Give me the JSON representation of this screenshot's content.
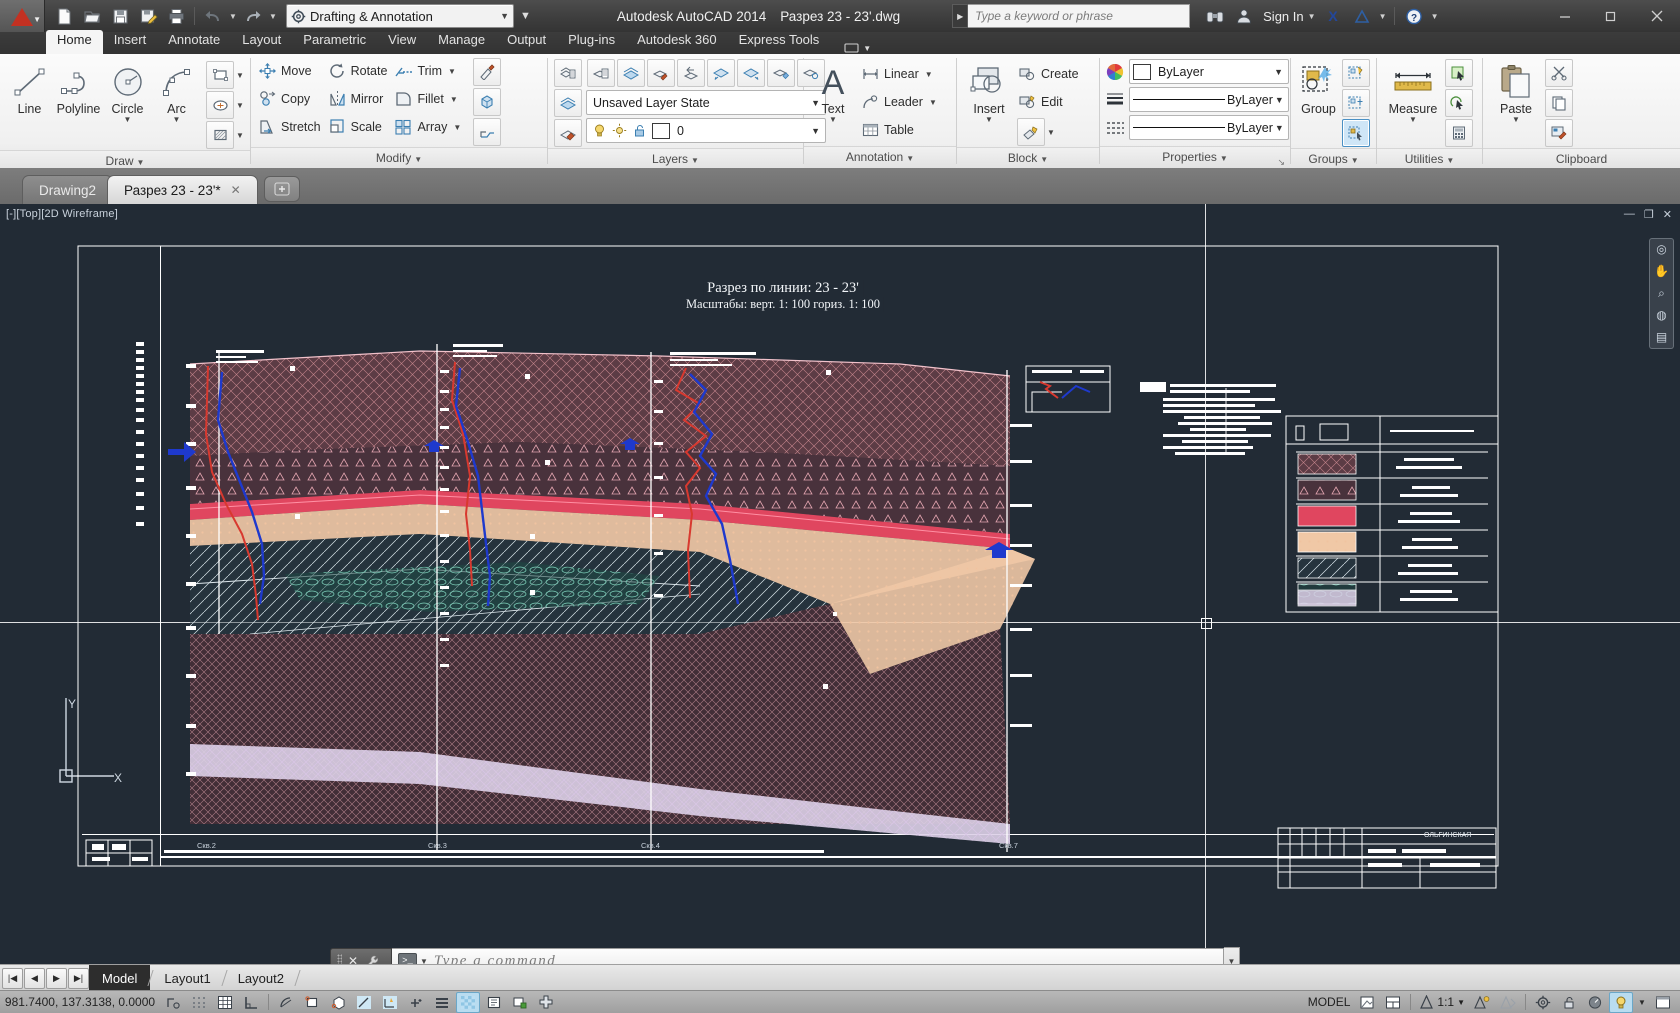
{
  "titlebar": {
    "app_title": "Autodesk AutoCAD 2014",
    "document_title": "Разрез 23 - 23'.dwg",
    "workspace": "Drafting & Annotation",
    "search_placeholder": "Type a keyword or phrase",
    "sign_in": "Sign In",
    "quick_access": [
      {
        "name": "new-file",
        "icon": "new-document-icon"
      },
      {
        "name": "open-file",
        "icon": "open-folder-icon"
      },
      {
        "name": "save-file",
        "icon": "save-disk-icon"
      },
      {
        "name": "save-as",
        "icon": "save-as-icon"
      },
      {
        "name": "plot",
        "icon": "printer-icon"
      },
      {
        "name": "undo",
        "icon": "undo-arrow-icon"
      },
      {
        "name": "redo",
        "icon": "redo-arrow-icon"
      }
    ],
    "window_buttons": {
      "minimize": "—",
      "maximize": "❐",
      "close": "✕"
    }
  },
  "ribbon_tabs": [
    {
      "label": "Home",
      "active": true
    },
    {
      "label": "Insert",
      "active": false
    },
    {
      "label": "Annotate",
      "active": false
    },
    {
      "label": "Layout",
      "active": false
    },
    {
      "label": "Parametric",
      "active": false
    },
    {
      "label": "View",
      "active": false
    },
    {
      "label": "Manage",
      "active": false
    },
    {
      "label": "Output",
      "active": false
    },
    {
      "label": "Plug-ins",
      "active": false
    },
    {
      "label": "Autodesk 360",
      "active": false
    },
    {
      "label": "Express Tools",
      "active": false
    }
  ],
  "panels": {
    "draw": {
      "title": "Draw",
      "buttons": [
        {
          "label": "Line",
          "icon": "line-icon"
        },
        {
          "label": "Polyline",
          "icon": "polyline-icon"
        },
        {
          "label": "Circle",
          "icon": "circle-icon",
          "dropdown": true
        },
        {
          "label": "Arc",
          "icon": "arc-icon",
          "dropdown": true
        }
      ],
      "small_icons": [
        "rectangle-icon",
        "ellipse-icon",
        "hatch-icon"
      ]
    },
    "modify": {
      "title": "Modify",
      "items": [
        {
          "label": "Move",
          "icon": "move-icon"
        },
        {
          "label": "Rotate",
          "icon": "rotate-icon"
        },
        {
          "label": "Trim",
          "icon": "trim-icon",
          "dropdown": true
        },
        {
          "label": "Copy",
          "icon": "copy-icon"
        },
        {
          "label": "Mirror",
          "icon": "mirror-icon"
        },
        {
          "label": "Fillet",
          "icon": "fillet-icon",
          "dropdown": true
        },
        {
          "label": "Stretch",
          "icon": "stretch-icon"
        },
        {
          "label": "Scale",
          "icon": "scale-icon"
        },
        {
          "label": "Array",
          "icon": "array-icon",
          "dropdown": true
        }
      ],
      "side_icons": [
        "match-properties-icon",
        "3d-solid-icon",
        "explode-icon"
      ]
    },
    "layers": {
      "title": "Layers",
      "layer_state": "Unsaved Layer State",
      "current_layer": "0",
      "layer_color": "#ffffff",
      "tool_icons": [
        "layer-properties-icon",
        "layer-make-current-icon",
        "layer-match-icon",
        "layer-previous-icon",
        "layer-isolate-icon",
        "layer-unisolate-icon",
        "layer-freeze-icon",
        "layer-off-icon"
      ],
      "state_icons": [
        "lightbulb-icon",
        "sun-icon",
        "unlock-icon"
      ]
    },
    "annotation": {
      "title": "Annotation",
      "big_button": {
        "label": "Text",
        "icon": "text-a-icon",
        "dropdown": true
      },
      "items": [
        {
          "label": "Linear",
          "icon": "linear-dimension-icon",
          "dropdown": true
        },
        {
          "label": "Leader",
          "icon": "leader-icon",
          "dropdown": true
        },
        {
          "label": "Table",
          "icon": "table-icon"
        }
      ]
    },
    "block": {
      "title": "Block",
      "big_button": {
        "label": "Insert",
        "icon": "insert-block-icon",
        "dropdown": true
      },
      "items": [
        {
          "label": "Create",
          "icon": "create-block-icon"
        },
        {
          "label": "Edit",
          "icon": "edit-block-icon"
        }
      ],
      "extra_icon": "block-attribute-icon"
    },
    "properties": {
      "title": "Properties",
      "color": "ByLayer",
      "linetype": "ByLayer",
      "lineweight": "ByLayer",
      "color_swatch": "#ffffff",
      "icons": [
        "color-wheel-icon",
        "lineweight-icon",
        "linetype-icon"
      ]
    },
    "groups": {
      "title": "Groups",
      "big_button": {
        "label": "Group",
        "icon": "group-icon"
      },
      "small_icons": [
        "ungroup-icon",
        "group-edit-icon",
        "group-selection-icon"
      ],
      "selected_icon": "group-selection-icon"
    },
    "utilities": {
      "title": "Utilities",
      "big_button": {
        "label": "Measure",
        "icon": "measure-ruler-icon",
        "dropdown": true
      },
      "small_icons": [
        "quick-select-icon",
        "quick-calc-icon",
        "calculator-icon"
      ]
    },
    "clipboard": {
      "title": "Clipboard",
      "big_button": {
        "label": "Paste",
        "icon": "paste-icon",
        "dropdown": true
      },
      "small_icons": [
        "cut-icon",
        "copy-clip-icon",
        "match-properties-clip-icon"
      ]
    }
  },
  "drawing_tabs": [
    {
      "label": "Drawing2",
      "active": false,
      "modified": false
    },
    {
      "label": "Разрез 23 - 23'*",
      "active": true,
      "modified": true
    }
  ],
  "new_tab_icon": "add-tab-icon",
  "viewport": {
    "label": "[-][Top][2D Wireframe]",
    "drawing_title_line1": "Разрез по линии:  23 - 23'",
    "drawing_title_line2": "Масштабы: верт. 1: 100 гориз. 1: 100",
    "borehole_labels": [
      "Скв.2",
      "Скв.3",
      "Скв.4",
      "Скв.7"
    ],
    "titleblock_company": "ОЛЬГИНСКАЯ",
    "window_controls": [
      "minimize-viewport",
      "maximize-viewport",
      "close-viewport"
    ],
    "nav_bar_icons": [
      "pan-hand-icon",
      "zoom-extents-icon",
      "orbit-icon",
      "showmotion-icon",
      "steeringwheel-icon"
    ]
  },
  "command_line": {
    "placeholder": "Type a command",
    "prompt_icon": "command-prompt-icon",
    "close_icon": "✕",
    "customize_icon": "wrench-icon"
  },
  "layout_tabs": [
    {
      "label": "Model",
      "active": true
    },
    {
      "label": "Layout1",
      "active": false
    },
    {
      "label": "Layout2",
      "active": false
    }
  ],
  "status_bar": {
    "coordinates": "981.7400, 137.3138, 0.0000",
    "space_mode": "MODEL",
    "annotation_scale": "1:1",
    "left_toggles": [
      {
        "name": "infer-constraints-icon",
        "on": false
      },
      {
        "name": "snap-mode-icon",
        "on": false
      },
      {
        "name": "grid-display-icon",
        "on": false
      },
      {
        "name": "ortho-mode-icon",
        "on": false
      },
      {
        "name": "polar-tracking-icon",
        "on": false
      },
      {
        "name": "object-snap-icon",
        "on": false
      },
      {
        "name": "3d-object-snap-icon",
        "on": false
      },
      {
        "name": "object-snap-tracking-icon",
        "on": false
      },
      {
        "name": "dynamic-ucs-icon",
        "on": false
      },
      {
        "name": "dynamic-input-icon",
        "on": false
      },
      {
        "name": "lineweight-display-icon",
        "on": false
      },
      {
        "name": "transparency-icon",
        "on": true
      },
      {
        "name": "selection-cycling-icon",
        "on": false
      },
      {
        "name": "annotation-monitor-icon",
        "on": false
      },
      {
        "name": "add-toggle-icon",
        "on": false
      }
    ],
    "right_items": [
      {
        "name": "model-space-button",
        "label": "MODEL"
      },
      {
        "name": "layout-viewport-icon"
      },
      {
        "name": "quick-view-layouts-icon"
      },
      {
        "name": "annotation-scale-icon"
      },
      {
        "name": "annotation-visibility-icon"
      },
      {
        "name": "auto-scale-icon"
      },
      {
        "name": "workspace-switch-icon"
      },
      {
        "name": "lock-toolbars-icon"
      },
      {
        "name": "isolate-objects-icon"
      },
      {
        "name": "hardware-acceleration-icon"
      },
      {
        "name": "clean-screen-icon"
      }
    ]
  },
  "colors": {
    "viewport_bg": "#222b35",
    "ribbon_bg": "#f2f2f2",
    "titlebar_bg": "#3e3e3e",
    "accent_blue": "#3c7fb1",
    "geo_red": "#d7594f",
    "geo_blue": "#2f46d0",
    "geo_pink": "#e8809a",
    "geo_peach": "#f2c9a8",
    "geo_lavender": "#ddd0e8"
  }
}
